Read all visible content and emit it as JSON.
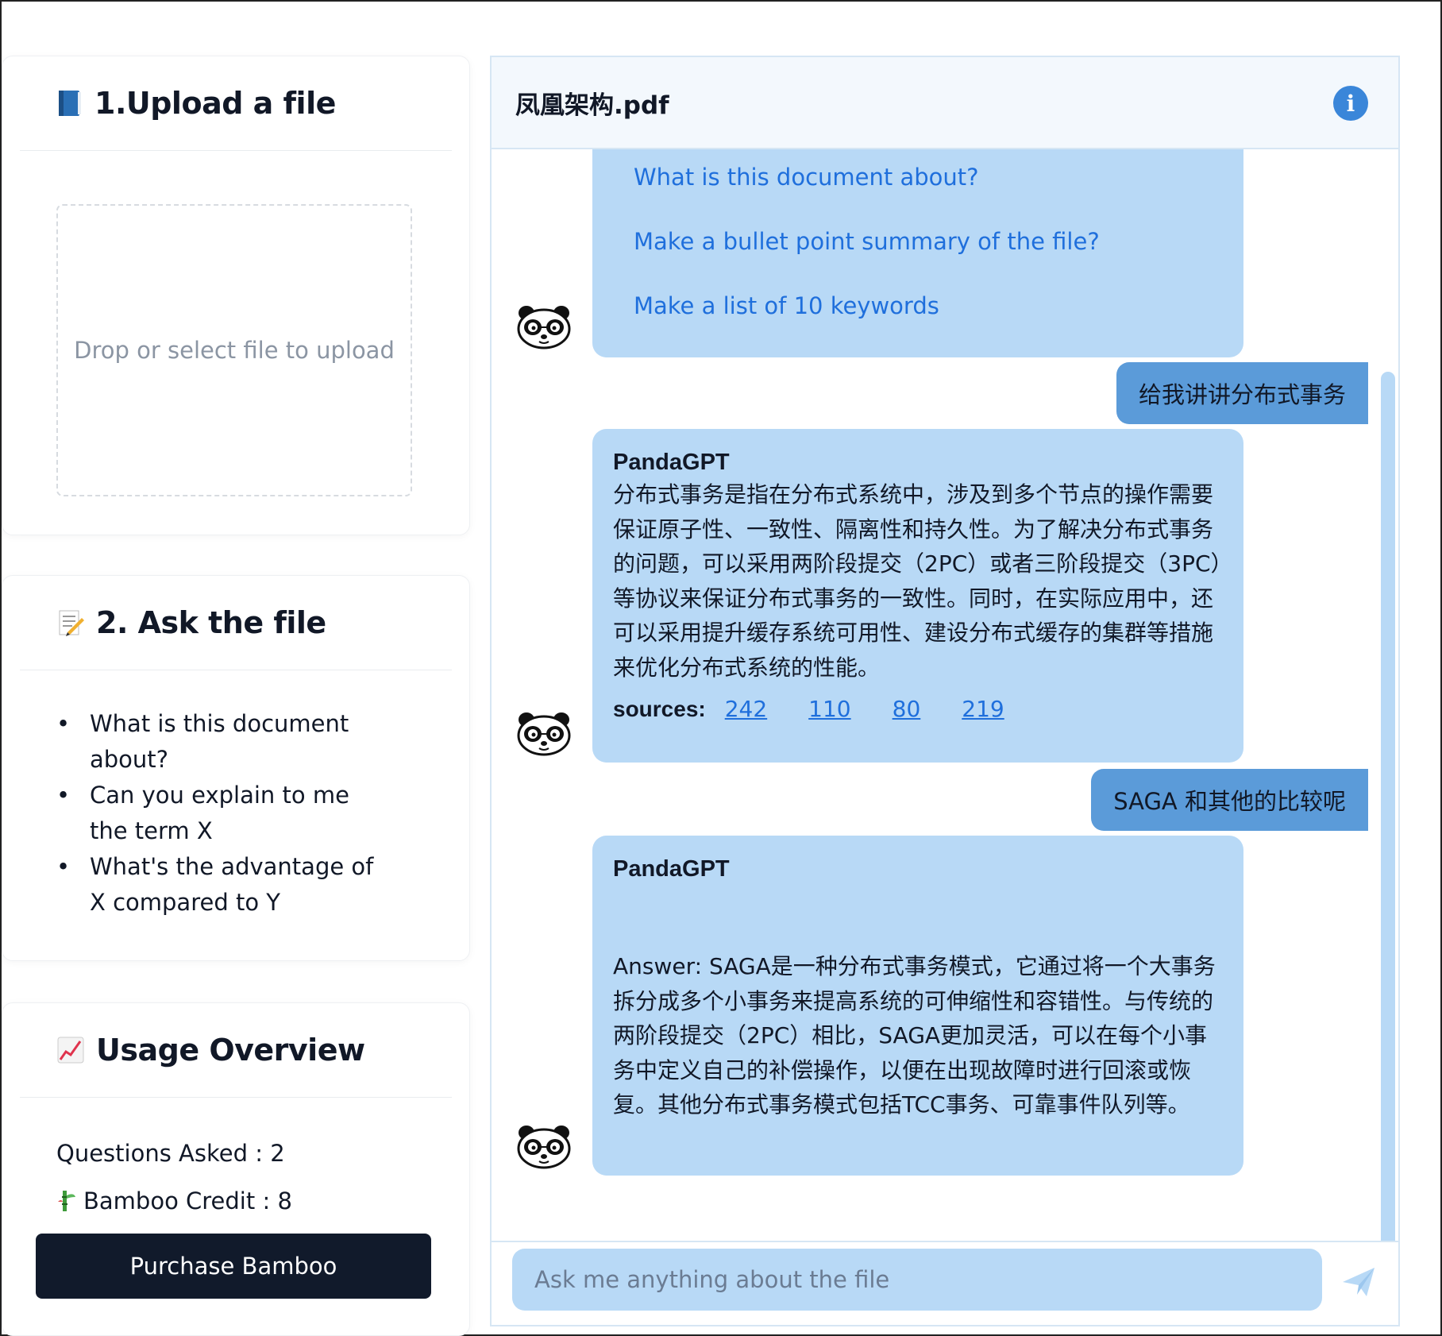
{
  "upload_panel": {
    "title": "1.Upload a file",
    "icon": "blue-book-icon",
    "dropzone_text": "Drop or select file to upload"
  },
  "ask_panel": {
    "title": "2. Ask the file",
    "icon": "memo-icon",
    "suggestions": [
      "What is this document about?",
      "Can you explain to me the term X",
      "What's the advantage of X compared to Y"
    ]
  },
  "usage_panel": {
    "title": "Usage Overview",
    "icon": "chart-increasing-icon",
    "questions_asked": "Questions Asked : 2",
    "bamboo_credit": "Bamboo Credit : 8",
    "bamboo_icon": "bamboo-icon",
    "purchase_label": "Purchase Bamboo"
  },
  "chat": {
    "file_name": "凤凰架构.pdf",
    "info_icon": "info-icon",
    "starter_prompts": [
      "What is this document about?",
      "Make a bullet point summary of the file?",
      "Make a list of 10 keywords"
    ],
    "messages": [
      {
        "role": "user",
        "text": "给我讲讲分布式事务"
      },
      {
        "role": "bot",
        "name": "PandaGPT",
        "text": "分布式事务是指在分布式系统中，涉及到多个节点的操作需要保证原子性、一致性、隔离性和持久性。为了解决分布式事务的问题，可以采用两阶段提交（2PC）或者三阶段提交（3PC）等协议来保证分布式事务的一致性。同时，在实际应用中，还可以采用提升缓存系统可用性、建设分布式缓存的集群等措施来优化分布式系统的性能。",
        "sources_label": "sources:",
        "sources": [
          "242",
          "110",
          "80",
          "219"
        ]
      },
      {
        "role": "user",
        "text": "SAGA 和其他的比较呢"
      },
      {
        "role": "bot",
        "name": "PandaGPT",
        "text": "Answer: SAGA是一种分布式事务模式，它通过将一个大事务拆分成多个小事务来提高系统的可伸缩性和容错性。与传统的两阶段提交（2PC）相比，SAGA更加灵活，可以在每个小事务中定义自己的补偿操作，以便在出现故障时进行回滚或恢复。其他分布式事务模式包括TCC事务、可靠事件队列等。"
      }
    ],
    "input_placeholder": "Ask me anything about the file",
    "send_icon": "send-icon",
    "avatar_icon": "panda-avatar-icon"
  },
  "colors": {
    "bubble_bot": "#b8d9f6",
    "bubble_user": "#5b9bd9",
    "link": "#1f6fdc",
    "button_dark": "#111a2b"
  }
}
